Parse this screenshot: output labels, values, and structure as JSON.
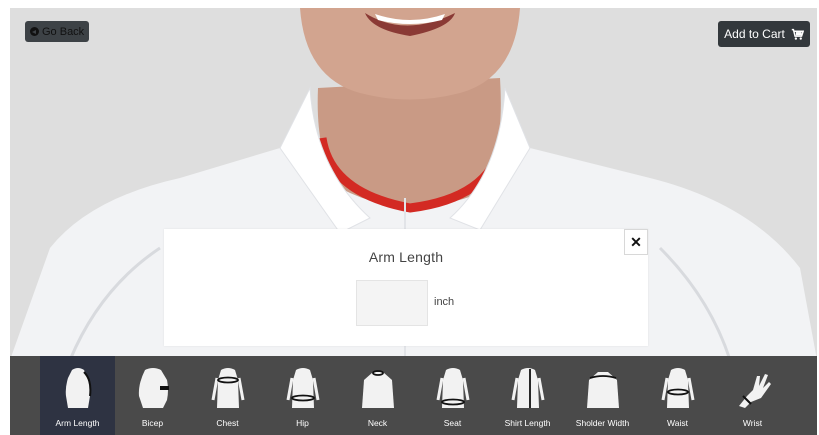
{
  "header": {
    "go_back_label": "Go Back",
    "add_to_cart_label": "Add to Cart"
  },
  "modal": {
    "title": "Arm Length",
    "input_value": "",
    "unit": "inch",
    "close_symbol": "✕"
  },
  "toolbar": {
    "active_index": 0,
    "items": [
      {
        "label": "Arm Length",
        "icon": "arm-length-icon"
      },
      {
        "label": "Bicep",
        "icon": "bicep-icon"
      },
      {
        "label": "Chest",
        "icon": "chest-icon"
      },
      {
        "label": "Hip",
        "icon": "hip-icon"
      },
      {
        "label": "Neck",
        "icon": "neck-icon"
      },
      {
        "label": "Seat",
        "icon": "seat-icon"
      },
      {
        "label": "Shirt Length",
        "icon": "shirt-length-icon"
      },
      {
        "label": "Sholder Width",
        "icon": "shoulder-width-icon"
      },
      {
        "label": "Waist",
        "icon": "waist-icon"
      },
      {
        "label": "Wrist",
        "icon": "wrist-icon"
      }
    ]
  },
  "colors": {
    "active_tool_bg": "#2e3342",
    "toolbar_bg": "#4a4a4a",
    "measure_highlight": "#d32a23"
  }
}
